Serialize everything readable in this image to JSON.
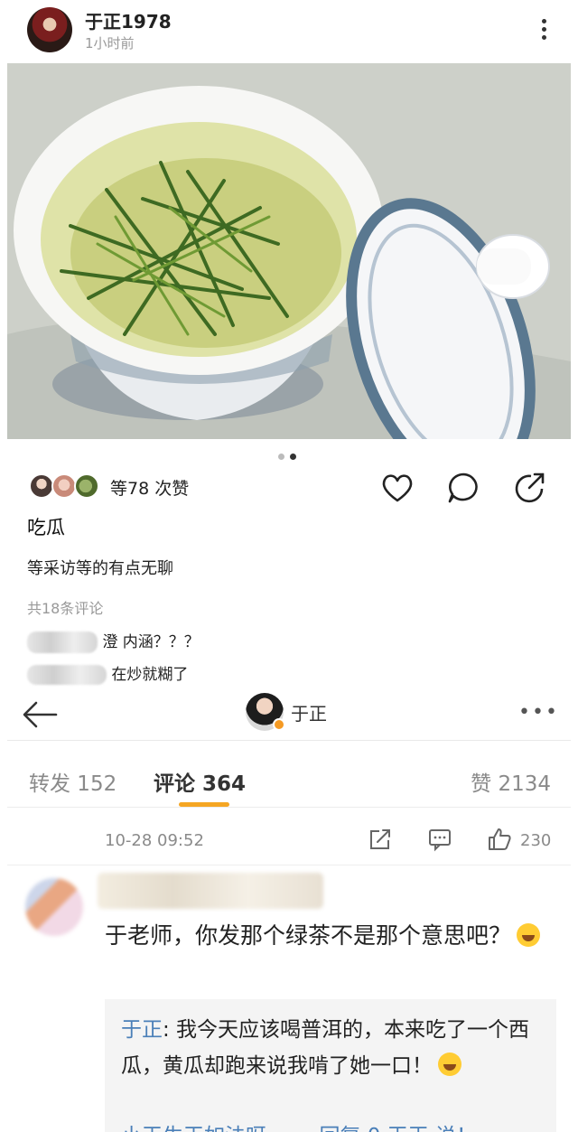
{
  "post": {
    "username": "于正1978",
    "time": "1小时前",
    "likes": "等78 次赞",
    "caption_title": "吃瓜",
    "caption_text": "等采访等的有点无聊",
    "comments_count": "共18条评论",
    "comment1_visible": "澄 内涵？？？",
    "comment2_visible": "在炒就糊了",
    "image_icon": "tea-cup-photo",
    "carousel_pages": 2,
    "carousel_active": 2
  },
  "weibo": {
    "nav_name": "于正",
    "more": "•••",
    "tabs": {
      "repost": "转发 152",
      "comment": "评论 364",
      "likes": "赞 2134"
    },
    "date": "10-28 09:52",
    "like_count": "230",
    "comment_text": "于老师，你发那个绿茶不是那个意思吧？",
    "reply_name": "于正",
    "reply_text": ": 我今天应该喝普洱的，本来吃了一个西瓜，黄瓜却跑来说我啃了她一口！",
    "reply_cut": "小王生王如法呀 ······ 回复 0 王王 说！",
    "accent_color": "#f5a623",
    "link_color": "#4a7fb8"
  }
}
